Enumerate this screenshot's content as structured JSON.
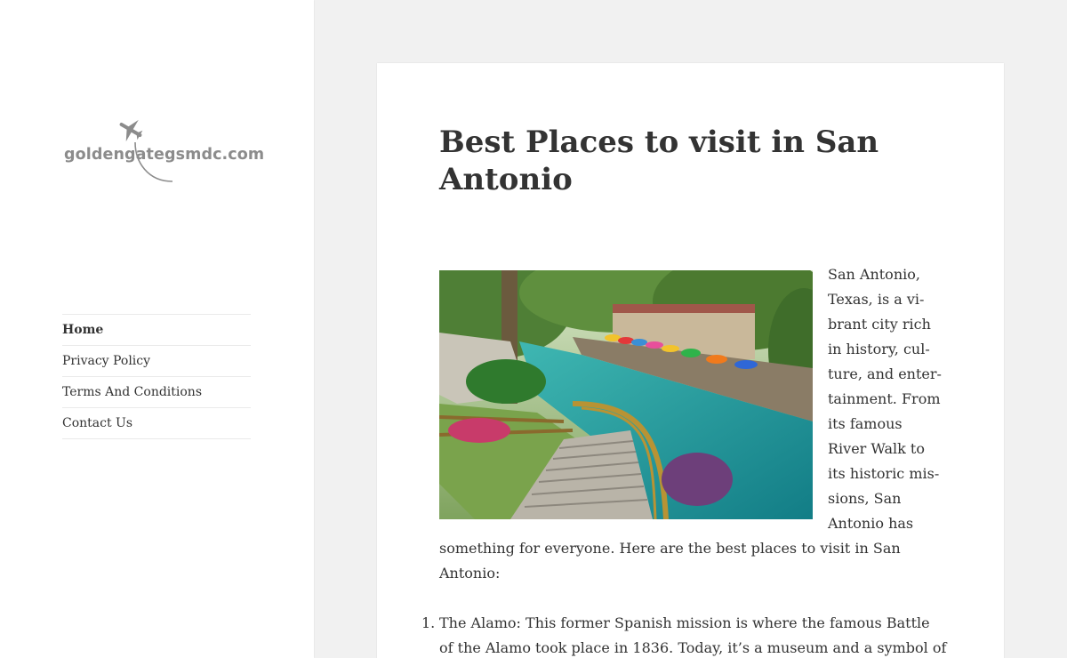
{
  "site": {
    "logo_text": "goldengategsmdc.com"
  },
  "nav": {
    "items": [
      {
        "label": "Home",
        "active": true
      },
      {
        "label": "Privacy Policy"
      },
      {
        "label": "Terms And Conditions"
      },
      {
        "label": "Contact Us"
      }
    ]
  },
  "article": {
    "title": "Best Places to visit in San Antonio",
    "intro_side_lines": [
      "San Antonio,",
      "Texas, is a vi-",
      "brant city rich",
      "in history, cul-",
      "ture, and enter-",
      "tainment. From",
      "its famous",
      "River Walk to",
      "its historic mis-",
      "sions, San",
      "Antonio has"
    ],
    "intro_wide_lines": [
      "something for everyone. Here are the best places to visit in San",
      "Antonio:"
    ],
    "list": [
      {
        "number": "1.",
        "lines": [
          "The Alamo: This former Spanish mission is where the famous Battle",
          "of the Alamo took place in 1836. Today, it’s a museum and a symbol of"
        ]
      }
    ]
  },
  "colors": {
    "background": "#f1f1f1",
    "panel": "#ffffff",
    "text": "#333333",
    "logo": "#8c8c8c",
    "divider": "#eaeaea"
  }
}
